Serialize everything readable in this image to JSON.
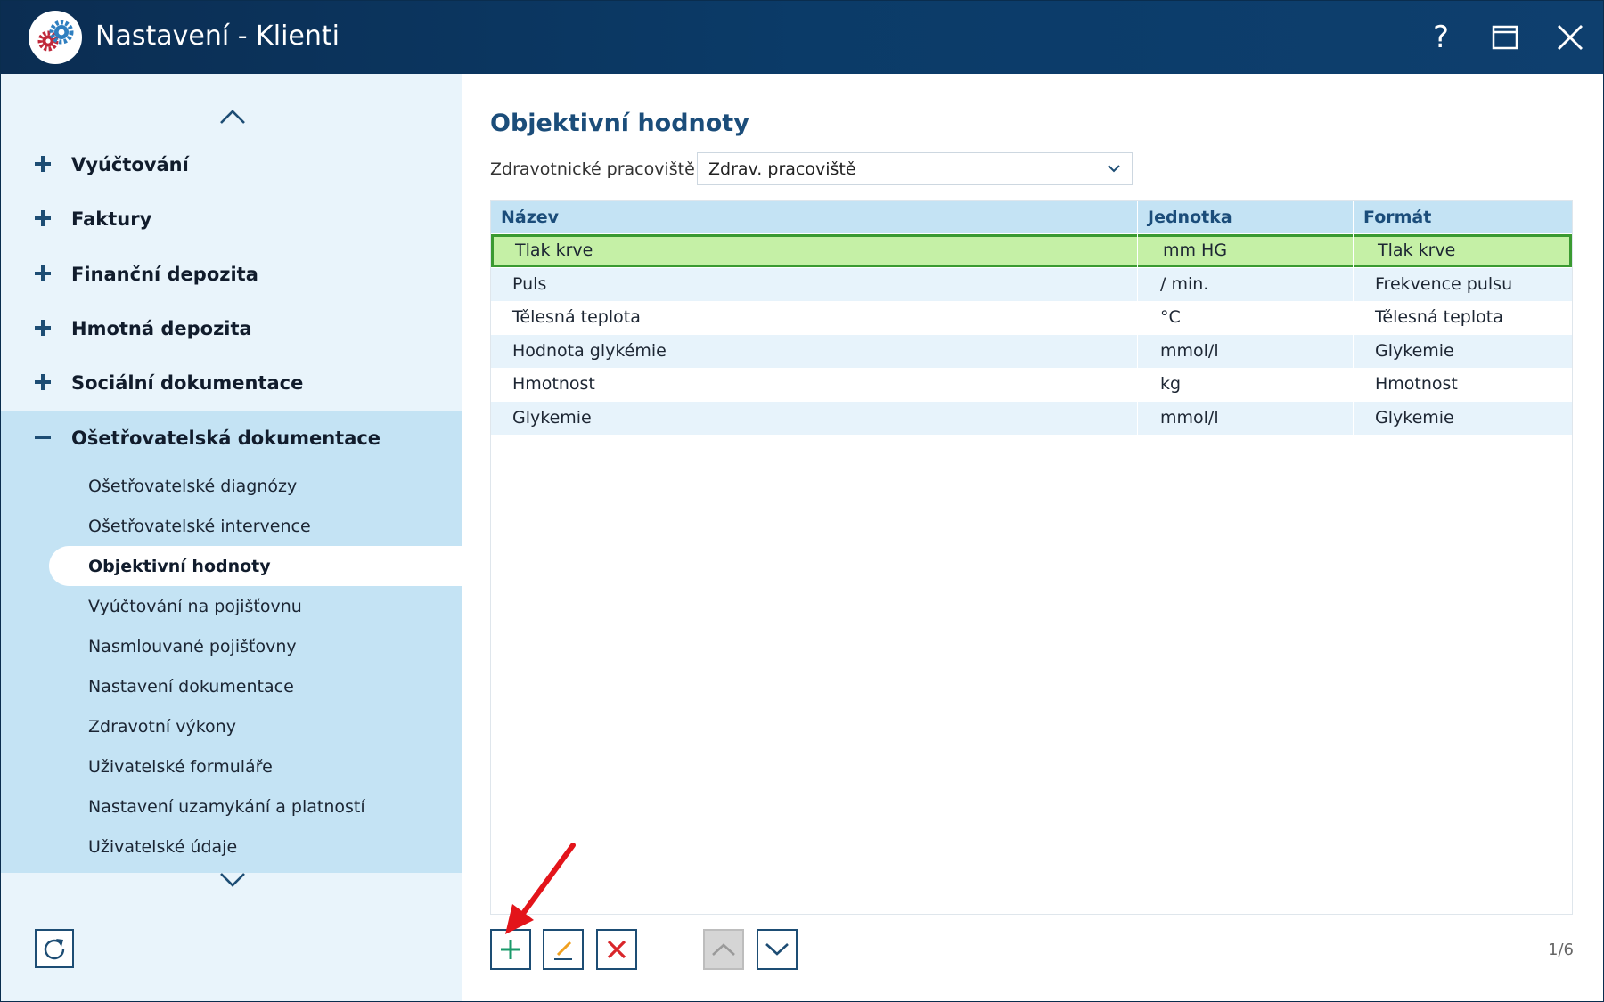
{
  "window": {
    "title": "Nastavení - Klienti",
    "help_label": "?"
  },
  "sidebar": {
    "categories": [
      {
        "label": "Vyúčtování",
        "expanded": false
      },
      {
        "label": "Faktury",
        "expanded": false
      },
      {
        "label": "Finanční depozita",
        "expanded": false
      },
      {
        "label": "Hmotná depozita",
        "expanded": false
      },
      {
        "label": "Sociální dokumentace",
        "expanded": false
      },
      {
        "label": "Ošetřovatelská dokumentace",
        "expanded": true
      }
    ],
    "sub_items": [
      {
        "label": "Ošetřovatelské diagnózy",
        "selected": false
      },
      {
        "label": "Ošetřovatelské intervence",
        "selected": false
      },
      {
        "label": "Objektivní hodnoty",
        "selected": true
      },
      {
        "label": "Vyúčtování na pojišťovnu",
        "selected": false
      },
      {
        "label": "Nasmlouvané pojišťovny",
        "selected": false
      },
      {
        "label": "Nastavení dokumentace",
        "selected": false
      },
      {
        "label": "Zdravotní výkony",
        "selected": false
      },
      {
        "label": "Uživatelské formuláře",
        "selected": false
      },
      {
        "label": "Nastavení uzamykání a platností",
        "selected": false
      },
      {
        "label": "Uživatelské údaje",
        "selected": false
      }
    ]
  },
  "main": {
    "title": "Objektivní hodnoty",
    "filter": {
      "label": "Zdravotnické pracoviště:",
      "value": "Zdrav. pracoviště"
    },
    "table": {
      "columns": [
        "Název",
        "Jednotka",
        "Formát"
      ],
      "rows": [
        {
          "name": "Tlak krve",
          "unit": "mm HG",
          "format": "Tlak krve",
          "selected": true
        },
        {
          "name": "Puls",
          "unit": "/ min.",
          "format": "Frekvence pulsu",
          "selected": false
        },
        {
          "name": "Tělesná teplota",
          "unit": "°C",
          "format": "Tělesná teplota",
          "selected": false
        },
        {
          "name": "Hodnota glykémie",
          "unit": "mmol/l",
          "format": "Glykemie",
          "selected": false
        },
        {
          "name": "Hmotnost",
          "unit": "kg",
          "format": "Hmotnost",
          "selected": false
        },
        {
          "name": "Glykemie",
          "unit": "mmol/l",
          "format": "Glykemie",
          "selected": false
        }
      ]
    },
    "pager": "1/6"
  },
  "colors": {
    "titlebar": "#0b3b68",
    "sidebar_bg": "#e9f4fb",
    "sidebar_active_group": "#c4e3f4",
    "header_bg": "#c4e3f4",
    "row_alt": "#e7f3fb",
    "selected_row": "#c5f0a6",
    "selected_border": "#3a9a31",
    "add_icon": "#1a9a6a",
    "delete_icon": "#d9262b",
    "annotation_arrow": "#e3141a"
  },
  "icons": {
    "logo": "gears-icon",
    "help": "question-icon",
    "maximize": "maximize-icon",
    "close": "close-icon",
    "refresh": "refresh-icon",
    "add": "plus-icon",
    "edit": "pencil-icon",
    "delete": "x-icon",
    "move_up": "chevron-up-icon",
    "move_down": "chevron-down-icon"
  }
}
